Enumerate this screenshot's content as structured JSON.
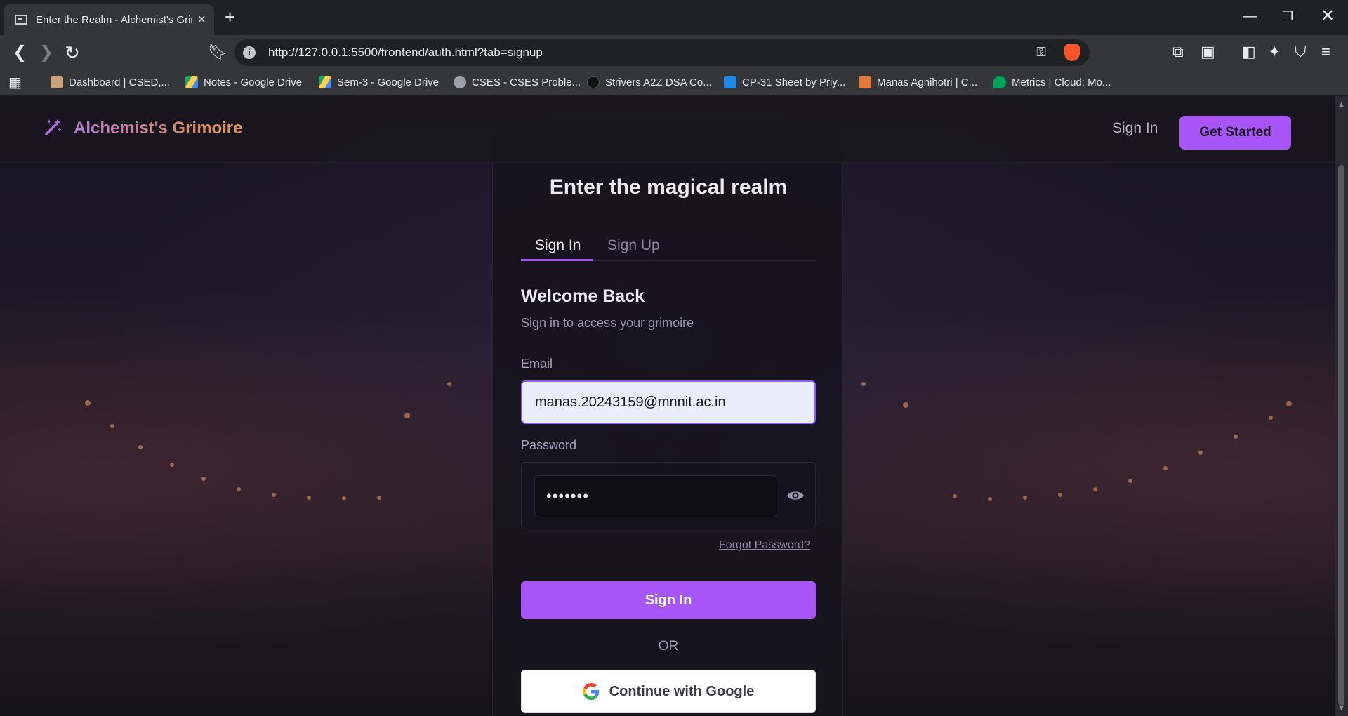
{
  "browser": {
    "tab_title": "Enter the Realm - Alchemist's Grimoire",
    "url": "http://127.0.0.1:5500/frontend/auth.html?tab=signup",
    "bookmarks": [
      {
        "label": "Dashboard | CSED,...",
        "color": "#c9a27a"
      },
      {
        "label": "Notes - Google Drive",
        "color": "#1fa463"
      },
      {
        "label": "Sem-3 - Google Drive",
        "color": "#1fa463"
      },
      {
        "label": "CSES - CSES Proble...",
        "color": "#9aa0a6"
      },
      {
        "label": "Strivers A2Z DSA Co...",
        "color": "#111111"
      },
      {
        "label": "CP-31 Sheet by Priy...",
        "color": "#1e88e5"
      },
      {
        "label": "Manas Agnihotri | C...",
        "color": "#e07a3f"
      },
      {
        "label": "Metrics | Cloud: Mo...",
        "color": "#00a35c"
      }
    ]
  },
  "header": {
    "brand": "Alchemist's Grimoire",
    "signin": "Sign In",
    "get_started": "Get Started"
  },
  "card": {
    "heading": "Enter the magical realm",
    "tabs": [
      "Sign In",
      "Sign Up"
    ],
    "welcome": "Welcome Back",
    "subtitle": "Sign in to access your grimoire",
    "email_label": "Email",
    "email_value": "manas.20243159@mnnit.ac.in",
    "password_label": "Password",
    "password_value": "•••••••",
    "forgot": "Forgot Password?",
    "signin_button": "Sign In",
    "or": "OR",
    "google_button": "Continue with Google"
  },
  "colors": {
    "accent": "#a855f7",
    "background": "#1c1826"
  }
}
